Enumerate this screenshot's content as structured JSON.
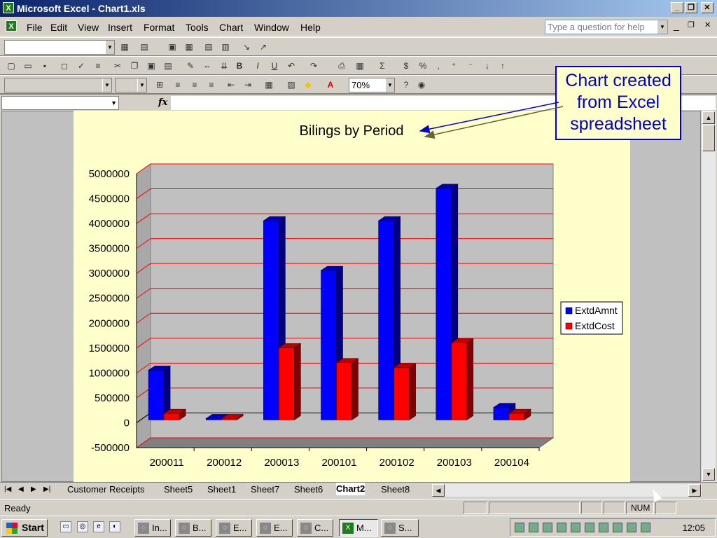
{
  "window": {
    "title": "Microsoft Excel - Chart1.xls",
    "minimize": "_",
    "restore": "❐",
    "close": "✕"
  },
  "menu": {
    "items": [
      "File",
      "Edit",
      "View",
      "Insert",
      "Format",
      "Tools",
      "Chart",
      "Window",
      "Help"
    ],
    "help_placeholder": "Type a question for help",
    "doc_min": "_",
    "doc_restore": "❐",
    "doc_close": "✕"
  },
  "toolbar": {
    "zoom": "70%"
  },
  "formula": {
    "fx": "fx"
  },
  "chart_data": {
    "type": "bar",
    "title": "Bilings by Period",
    "categories": [
      "200011",
      "200012",
      "200013",
      "200101",
      "200102",
      "200103",
      "200104"
    ],
    "series": [
      {
        "name": "ExtdAmnt",
        "color": "#0000ff",
        "values": [
          1000000,
          0,
          4000000,
          3000000,
          4000000,
          4650000,
          250000
        ]
      },
      {
        "name": "ExtdCost",
        "color": "#ff0000",
        "values": [
          130000,
          0,
          1450000,
          1150000,
          1050000,
          1550000,
          130000
        ]
      }
    ],
    "ylim": [
      -500000,
      5000000
    ],
    "yticks": [
      "5000000",
      "4500000",
      "4000000",
      "3500000",
      "3000000",
      "2500000",
      "2000000",
      "1500000",
      "1000000",
      "500000",
      "0",
      "-500000"
    ],
    "xlabel": "",
    "ylabel": "",
    "grid": true,
    "legend": "right",
    "style": "3d-clustered-column"
  },
  "callout": {
    "line1": "Chart created",
    "line2": "from Excel",
    "line3": "spreadsheet"
  },
  "sheets": {
    "tabs": [
      "Customer Receipts",
      "Sheet5",
      "Sheet1",
      "Sheet7",
      "Sheet6",
      "Chart2",
      "Sheet8"
    ],
    "active": "Chart2"
  },
  "status": {
    "text": "Ready",
    "num": "NUM"
  },
  "taskbar": {
    "start": "Start",
    "tasks": [
      "In...",
      "B...",
      "E...",
      "E...",
      "C...",
      "M...",
      "S..."
    ],
    "clock": "12:05"
  }
}
